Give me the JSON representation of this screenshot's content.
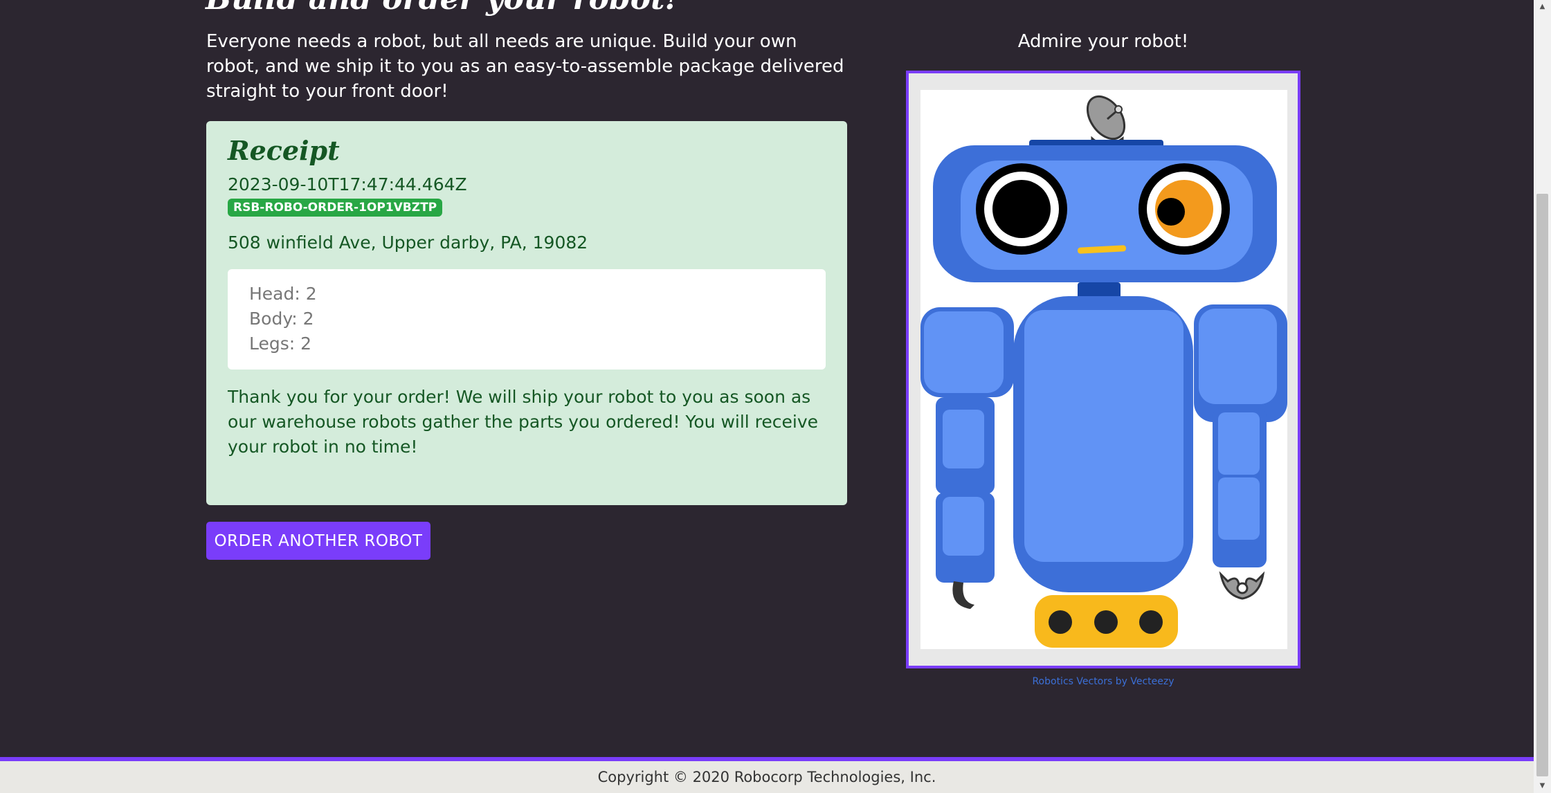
{
  "header": {
    "title": "Build and order your robot!",
    "intro": "Everyone needs a robot, but all needs are unique. Build your own robot, and we ship it to you as an easy-to-assemble package delivered straight to your front door!"
  },
  "receipt": {
    "heading": "Receipt",
    "timestamp": "2023-09-10T17:47:44.464Z",
    "order_id": "RSB-ROBO-ORDER-1OP1VBZTP",
    "address": "508 winfield Ave, Upper darby, PA, 19082",
    "parts": {
      "head": "Head: 2",
      "body": "Body: 2",
      "legs": "Legs: 2"
    },
    "thanks": "Thank you for your order! We will ship your robot to you as soon as our warehouse robots gather the parts you ordered! You will receive your robot in no time!"
  },
  "actions": {
    "order_another": "ORDER ANOTHER ROBOT"
  },
  "preview": {
    "title": "Admire your robot!",
    "credit": "Robotics Vectors by Vecteezy"
  },
  "footer": {
    "copyright": "Copyright © 2020 Robocorp Technologies, Inc."
  },
  "colors": {
    "background": "#2c2630",
    "accent": "#7a3dfa",
    "receipt_bg": "#d4ecdb",
    "receipt_text": "#155724",
    "badge": "#28a745",
    "robot_blue": "#3d6fd8",
    "robot_light_blue": "#6193f5",
    "robot_yellow": "#f8b91c"
  }
}
